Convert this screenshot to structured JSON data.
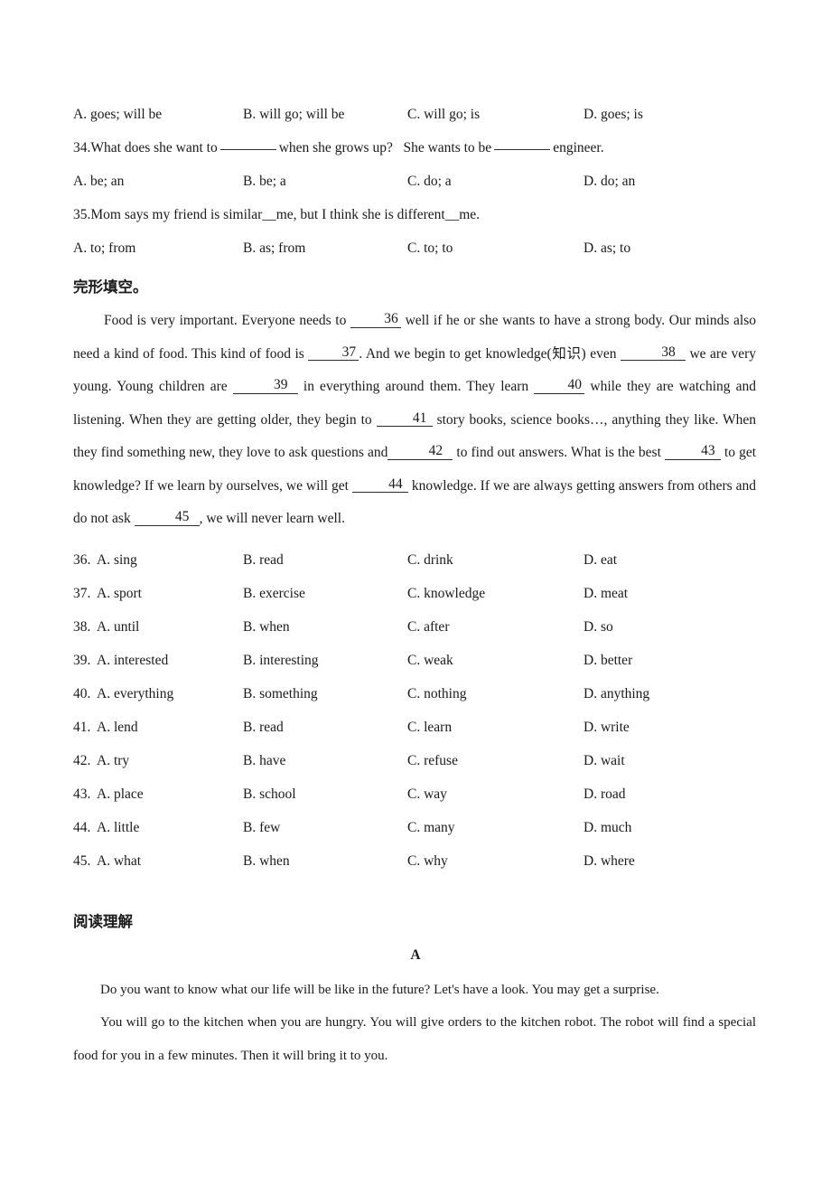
{
  "document": {
    "type": "english-exam-paper"
  },
  "question_33_options": {
    "a": "A. goes; will be",
    "b": "B. will go; will be",
    "c": "C. will go; is",
    "d": "D. goes; is"
  },
  "question_34": {
    "stem_part1": "34.What does she want to",
    "stem_part2": "when she grows up?",
    "stem_part3": "She wants to be",
    "stem_part4": "engineer.",
    "options": {
      "a": "A. be; an",
      "b": "B. be; a",
      "c": "C. do; a",
      "d": "D. do; an"
    }
  },
  "question_35": {
    "stem": "35.Mom says my friend is similar__me, but I think she is different__me.",
    "options": {
      "a": "A. to; from",
      "b": "B. as; from",
      "c": "C. to; to",
      "d": "D. as; to"
    }
  },
  "cloze": {
    "heading": "完形填空。",
    "passage": {
      "s1": "Food is very important. Everyone needs to",
      "b36": "36",
      "s2": "well if he or she wants to have a strong body. Our minds also need a kind of food. This kind of food is",
      "b37": "37",
      "s3": ". And we begin to get knowledge(知识) even",
      "b38": "38",
      "s4": "we are very young. Young children are",
      "b39": "39",
      "s5": "in everything around them. They learn",
      "b40": "40",
      "s6": "while they are watching and listening. When they are getting older, they begin to",
      "b41": "41",
      "s7": "story books, science books…, anything they like. When they find something new, they love to ask questions and",
      "b42": "42",
      "s8": "to find out answers. What is the best",
      "b43": "43",
      "s9": "to get knowledge? If we learn by ourselves, we will get",
      "b44": "44",
      "s10": "knowledge. If we are always getting answers from others and do not ask",
      "b45": "45",
      "s11": ", we will never learn well."
    },
    "options": [
      {
        "num": "36.",
        "a": "A. sing",
        "b": "B. read",
        "c": "C. drink",
        "d": "D. eat"
      },
      {
        "num": "37.",
        "a": "A. sport",
        "b": "B. exercise",
        "c": "C. knowledge",
        "d": "D. meat"
      },
      {
        "num": "38.",
        "a": "A. until",
        "b": "B. when",
        "c": "C. after",
        "d": "D. so"
      },
      {
        "num": "39.",
        "a": "A. interested",
        "b": "B. interesting",
        "c": "C. weak",
        "d": "D. better"
      },
      {
        "num": "40.",
        "a": "A. everything",
        "b": "B. something",
        "c": "C. nothing",
        "d": "D. anything"
      },
      {
        "num": "41.",
        "a": "A. lend",
        "b": "B. read",
        "c": "C. learn",
        "d": "D. write"
      },
      {
        "num": "42.",
        "a": "A. try",
        "b": "B. have",
        "c": "C. refuse",
        "d": "D. wait"
      },
      {
        "num": "43.",
        "a": "A. place",
        "b": "B. school",
        "c": "C. way",
        "d": "D. road"
      },
      {
        "num": "44.",
        "a": "A. little",
        "b": "B. few",
        "c": "C. many",
        "d": "D. much"
      },
      {
        "num": "45.",
        "a": "A. what",
        "b": "B. when",
        "c": "C. why",
        "d": "D. where"
      }
    ]
  },
  "reading": {
    "heading": "阅读理解",
    "passage_label": "A",
    "para1": "Do you want to know what our life will be like in the future? Let's have a look. You may get a surprise.",
    "para2": "You will go to the kitchen when you are hungry. You will give orders to the kitchen robot. The robot will find a special food for you in a few minutes. Then it will bring it to you."
  }
}
